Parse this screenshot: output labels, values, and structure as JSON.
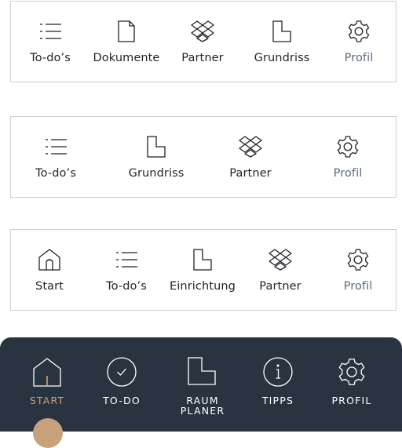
{
  "bar1": {
    "items": [
      {
        "label": "To-do’s",
        "icon": "list-icon"
      },
      {
        "label": "Dokumente",
        "icon": "document-icon"
      },
      {
        "label": "Partner",
        "icon": "dropbox-icon"
      },
      {
        "label": "Grundriss",
        "icon": "floorplan-icon"
      },
      {
        "label": "Profil",
        "icon": "gear-icon"
      }
    ]
  },
  "bar2": {
    "items": [
      {
        "label": "To-do’s",
        "icon": "list-icon"
      },
      {
        "label": "Grundriss",
        "icon": "floorplan-icon"
      },
      {
        "label": "Partner",
        "icon": "dropbox-icon"
      },
      {
        "label": "Profil",
        "icon": "gear-icon"
      }
    ]
  },
  "bar3": {
    "items": [
      {
        "label": "Start",
        "icon": "home-icon"
      },
      {
        "label": "To-do’s",
        "icon": "list-icon"
      },
      {
        "label": "Einrichtung",
        "icon": "floorplan-icon"
      },
      {
        "label": "Partner",
        "icon": "dropbox-icon"
      },
      {
        "label": "Profil",
        "icon": "gear-icon"
      }
    ]
  },
  "dark_bar": {
    "active_index": 0,
    "items": [
      {
        "label": "START",
        "icon": "home-icon"
      },
      {
        "label": "TO-DO",
        "icon": "check-circle-icon"
      },
      {
        "label_line1": "RAUM",
        "label_line2": "PLANER",
        "icon": "floorplan-icon"
      },
      {
        "label": "TIPPS",
        "icon": "info-icon"
      },
      {
        "label": "PROFIL",
        "icon": "gear-icon"
      }
    ]
  },
  "colors": {
    "text": "#1f2328",
    "muted": "#5b6b7d",
    "dark_bg": "#2a3440",
    "accent": "#c8a27a",
    "border": "#cfcfcf"
  }
}
